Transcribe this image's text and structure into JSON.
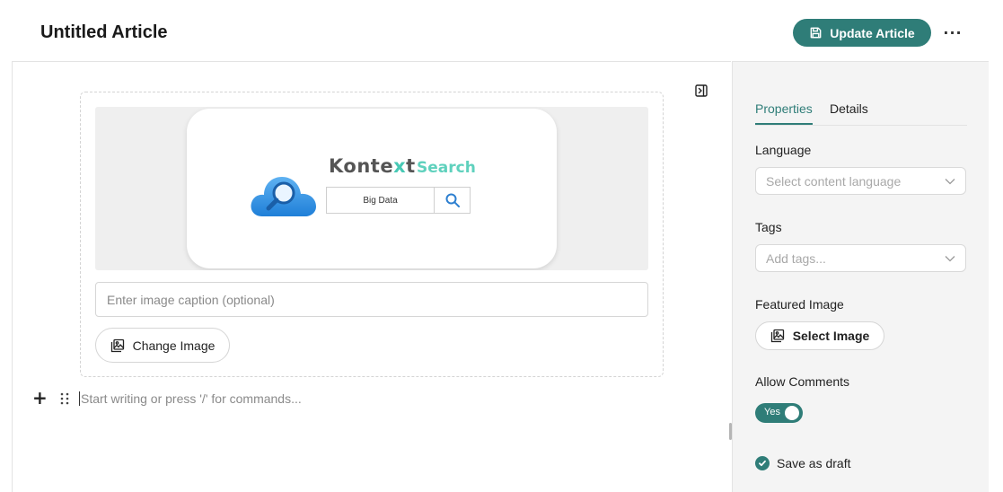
{
  "header": {
    "title": "Untitled Article",
    "update_label": "Update Article",
    "more_label": "···"
  },
  "editor": {
    "image": {
      "brand_prefix": "Konte",
      "brand_x": "x",
      "brand_suffix": "t",
      "brand_search": "Search",
      "search_query": "Big Data"
    },
    "caption_placeholder": "Enter image caption (optional)",
    "change_image_label": "Change Image",
    "add_block_label": "+",
    "writing_placeholder": "Start writing or press '/' for commands..."
  },
  "sidebar": {
    "tabs": [
      {
        "label": "Properties",
        "active": true
      },
      {
        "label": "Details",
        "active": false
      }
    ],
    "language": {
      "label": "Language",
      "placeholder": "Select content language"
    },
    "tags": {
      "label": "Tags",
      "placeholder": "Add tags..."
    },
    "featured_image": {
      "label": "Featured Image",
      "button_label": "Select Image"
    },
    "allow_comments": {
      "label": "Allow Comments",
      "toggle_label": "Yes",
      "on": true
    },
    "save_draft": {
      "label": "Save as draft",
      "checked": true
    }
  },
  "colors": {
    "accent": "#2f7d78",
    "brand_teal": "#5fd1bd",
    "cloud_blue": "#2d8fe6"
  },
  "icons": {
    "update": "save-icon",
    "collapse": "panel-collapse-icon",
    "change_image": "image-icon",
    "search": "search-icon",
    "dropdown": "chevron-down-icon",
    "drag": "drag-handle-icon",
    "checkbox": "check-icon"
  }
}
